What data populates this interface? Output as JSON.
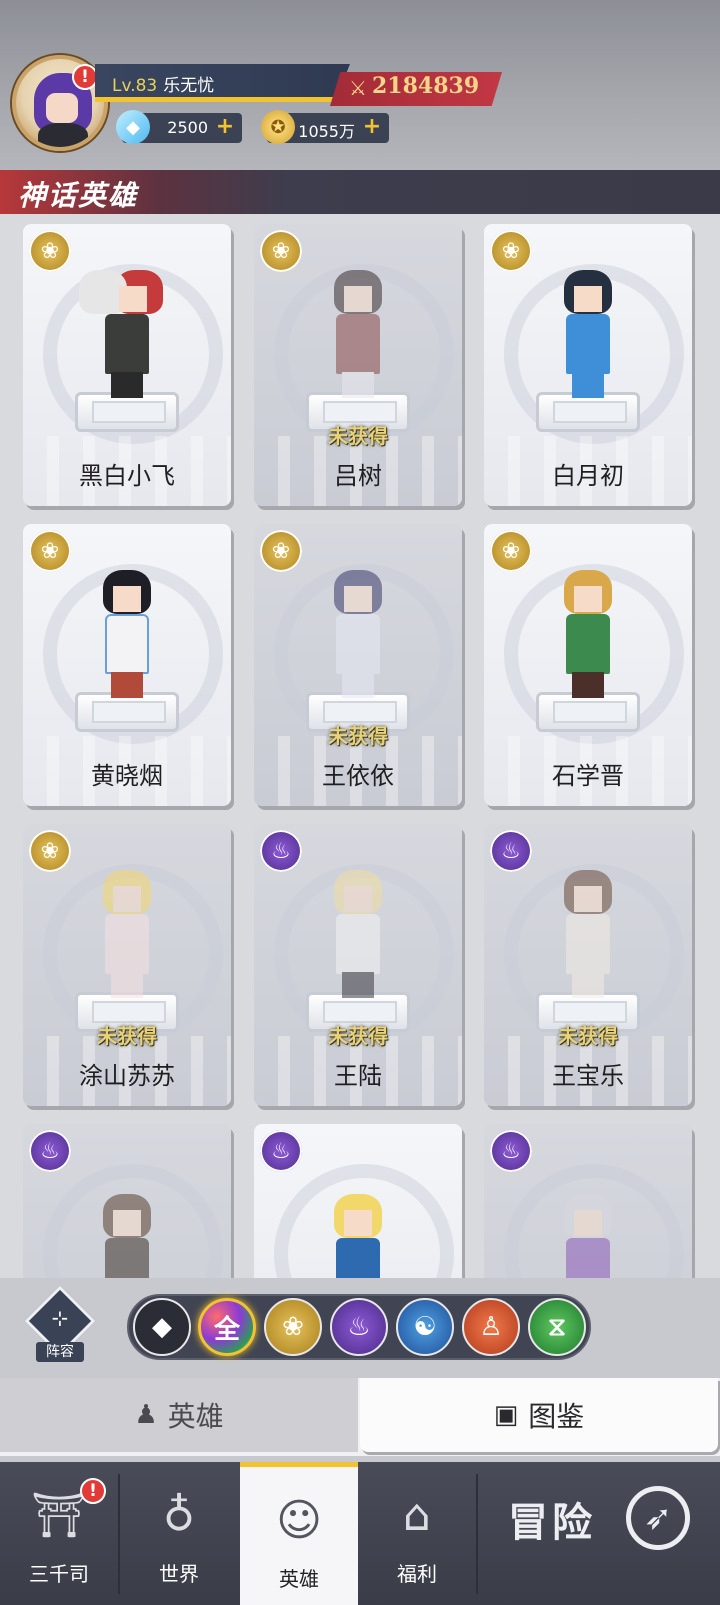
{
  "player": {
    "level": "Lv.83",
    "name": "乐无忧",
    "power": "2184839",
    "alert": "!",
    "level_progress": 0.95
  },
  "resources": {
    "gems": "2500",
    "gold": "1055万",
    "plus": "+"
  },
  "section_title": "神话英雄",
  "heroes": [
    {
      "name": "黑白小飞",
      "status": "",
      "badge": "lotus"
    },
    {
      "name": "吕树",
      "status": "未获得",
      "badge": "lotus"
    },
    {
      "name": "白月初",
      "status": "",
      "badge": "lotus"
    },
    {
      "name": "黄晓烟",
      "status": "",
      "badge": "lotus"
    },
    {
      "name": "王依依",
      "status": "未获得",
      "badge": "lotus"
    },
    {
      "name": "石学晋",
      "status": "",
      "badge": "lotus"
    },
    {
      "name": "涂山苏苏",
      "status": "未获得",
      "badge": "lotus"
    },
    {
      "name": "王陆",
      "status": "未获得",
      "badge": "flame"
    },
    {
      "name": "王宝乐",
      "status": "未获得",
      "badge": "flame"
    },
    {
      "name": "",
      "status": "",
      "badge": "flame"
    },
    {
      "name": "",
      "status": "",
      "badge": "flame"
    },
    {
      "name": "",
      "status": "",
      "badge": "flame"
    }
  ],
  "lineup_label": "阵容",
  "filters": {
    "all_label": "全",
    "selected": "全"
  },
  "tabs": {
    "heroes": "英雄",
    "atlas": "图鉴"
  },
  "nav": {
    "sanqiansi": "三千司",
    "world": "世界",
    "heroes": "英雄",
    "welfare": "福利",
    "adventure": "冒险",
    "alert": "!"
  },
  "colors": {
    "accent_gold": "#f2c230",
    "power_red": "#c23844",
    "unobtained_text": "#e7d27a"
  }
}
